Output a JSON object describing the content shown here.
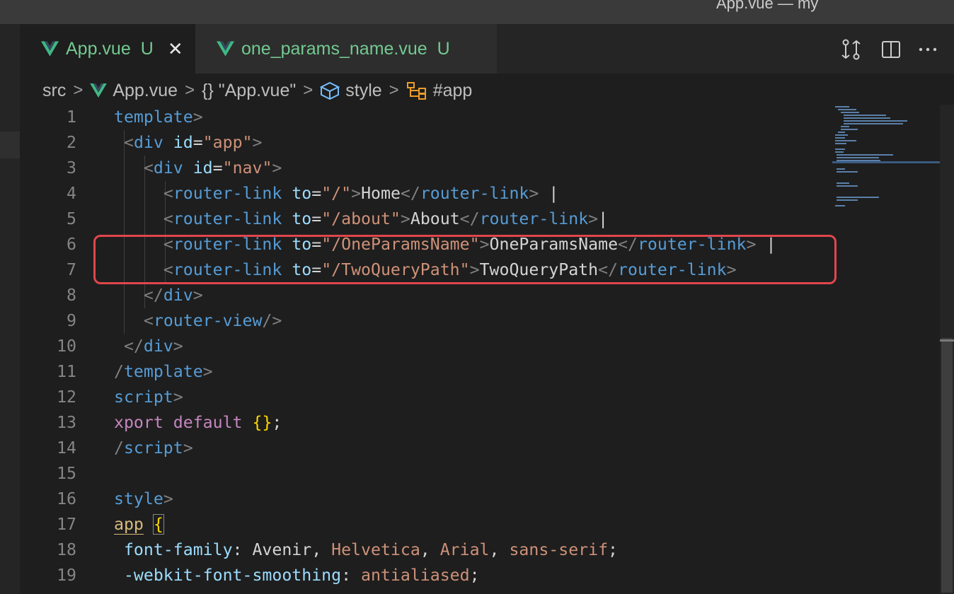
{
  "window": {
    "title": "App.vue — my"
  },
  "tabs": [
    {
      "label": "App.vue",
      "status": "U",
      "close": "✕",
      "icon": "vue-icon"
    },
    {
      "label": "one_params_name.vue",
      "status": "U",
      "icon": "vue-icon"
    }
  ],
  "editor_actions": [
    "open-changes-icon",
    "split-editor-icon",
    "more-actions-icon"
  ],
  "breadcrumb": {
    "root": "src",
    "file": "App.vue",
    "section": "{} \"App.vue\"",
    "block": "style",
    "symbol": "#app",
    "separator": ">"
  },
  "code_lines": [
    {
      "n": "1"
    },
    {
      "n": "2"
    },
    {
      "n": "3"
    },
    {
      "n": "4"
    },
    {
      "n": "5"
    },
    {
      "n": "6"
    },
    {
      "n": "7"
    },
    {
      "n": "8"
    },
    {
      "n": "9"
    },
    {
      "n": "10"
    },
    {
      "n": "11"
    },
    {
      "n": "12"
    },
    {
      "n": "13"
    },
    {
      "n": "14"
    },
    {
      "n": "15"
    },
    {
      "n": "16"
    },
    {
      "n": "17"
    },
    {
      "n": "18"
    },
    {
      "n": "19"
    }
  ],
  "code_tokens": {
    "template_kw": "template",
    "script_kw": "script",
    "style_kw": "style",
    "div": "div",
    "id_attr": "id",
    "to_attr": "to",
    "app_str": "\"app\"",
    "nav_str": "\"nav\"",
    "router_link": "router-link",
    "router_view": "router-view",
    "home_to": "\"/\"",
    "home_text": "Home",
    "about_to": "\"/about\"",
    "about_text": "About",
    "one_to": "\"/OneParamsName\"",
    "one_text": "OneParamsName",
    "two_to": "\"/TwoQueryPath\"",
    "two_text": "TwoQueryPath",
    "pipe": "|",
    "xport": "xport",
    "default_kw": "default",
    "braces": "{}",
    "semi": ";",
    "app_sel": "app",
    "open_brace": "{",
    "font_family_prop": "font-family",
    "avenir": "Avenir",
    "helvetica": "Helvetica",
    "arial": "Arial",
    "sans_serif": "sans-serif",
    "webkit_prop": "-webkit-font-smoothing",
    "antialiased": "antialiased"
  },
  "colors": {
    "background": "#1e1e1e",
    "tag": "#569cd6",
    "attribute": "#9cdcfe",
    "string": "#ce9178",
    "keyword": "#c586c0",
    "bracket": "#ffd700",
    "untracked": "#73c991",
    "highlight_box": "#e0464c"
  }
}
